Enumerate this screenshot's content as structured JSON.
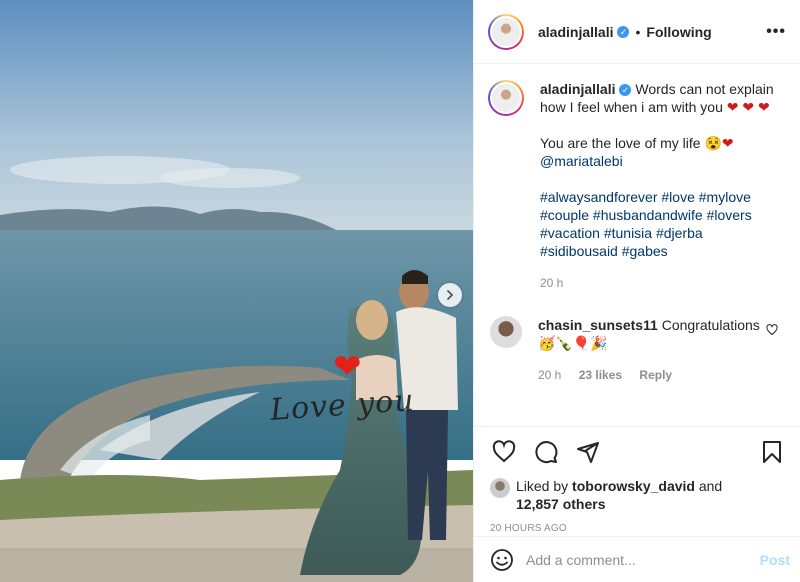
{
  "post": {
    "author": "aladinjallali",
    "follow_status": "Following",
    "more_label": "•••",
    "separator": "•"
  },
  "photo": {
    "overlay_text": "Love you",
    "heart_sticker": "❤",
    "next_icon": "chevron-right-icon"
  },
  "caption": {
    "author": "aladinjallali",
    "line1": "Words can not explain how I feel when i am with you",
    "hearts1": "❤ ❤ ❤",
    "line2": "You are the love of my life",
    "emoji2": "😵❤",
    "mention": "@mariatalebi",
    "hashtags": [
      "#alwaysandforever #love #mylove",
      "#couple #husbandandwife #lovers",
      "#vacation #tunisia #djerba",
      "#sidibousaid #gabes"
    ],
    "time": "20 h"
  },
  "reply": {
    "author": "chasin_sunsets11",
    "text": "Congratulations",
    "emojis": "🥳🍾🎈🎉",
    "time": "20 h",
    "likes": "23 likes",
    "reply_label": "Reply"
  },
  "likes": {
    "prefix": "Liked by",
    "user": "toborowsky_david",
    "and": "and",
    "others": "12,857 others"
  },
  "timestamp": "20 HOURS AGO",
  "comment_box": {
    "placeholder": "Add a comment...",
    "post_label": "Post"
  },
  "colors": {
    "link": "#00376b",
    "verified": "#3897f0",
    "post_disabled": "#b2dffc",
    "heart": "#d11b1b"
  }
}
